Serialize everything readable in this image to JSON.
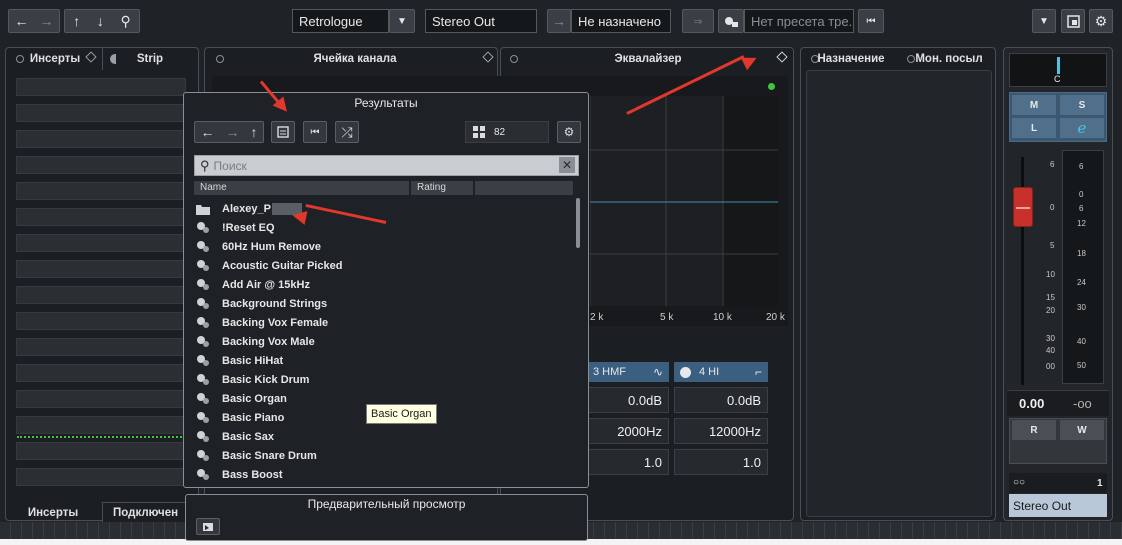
{
  "toolbar": {
    "nav_back_icon": "←",
    "nav_forward_icon": "→",
    "nav_up_icon": "↑",
    "nav_down_icon": "↓",
    "search_icon": "⚲",
    "plugin_name": "Retrologue",
    "output_name": "Stereo Out",
    "assign_arrow_icon": "→",
    "assign_status": "Не назначено",
    "preset_placeholder": "Нет пресета тре.",
    "skip_back_icon": "⏮",
    "dropdown_icon": "▼"
  },
  "tabs": {
    "inserts": "Инсерты",
    "strip": "Strip",
    "channel_cell": "Ячейка канала",
    "equalizer": "Эквалайзер",
    "routing": "Назначение",
    "mon_sends": "Мон. посыл"
  },
  "bottom_tabs": {
    "inserts": "Инсерты",
    "connections": "Подключен"
  },
  "eq": {
    "freq_labels": [
      "2 k",
      "5 k",
      "10 k",
      "20 k"
    ],
    "bands": [
      {
        "name": "3 HMF",
        "gain": "0.0dB",
        "freq": "2000Hz",
        "q": "1.0"
      },
      {
        "name": "4 HI",
        "gain": "0.0dB",
        "freq": "12000Hz",
        "q": "1.0"
      }
    ]
  },
  "results_dialog": {
    "title": "Результаты",
    "count": "82",
    "search_placeholder": "Поиск",
    "columns": [
      "Name",
      "Rating"
    ],
    "folder": "Alexey_P",
    "presets": [
      "!Reset EQ",
      "60Hz Hum Remove",
      "Acoustic Guitar Picked",
      "Add Air @ 15kHz",
      "Background Strings",
      "Backing Vox Female",
      "Backing Vox Male",
      "Basic HiHat",
      "Basic Kick Drum",
      "Basic Organ",
      "Basic Piano",
      "Basic Sax",
      "Basic Snare Drum",
      "Bass Boost"
    ],
    "tooltip": "Basic Organ"
  },
  "preview_dialog": {
    "title": "Предварительный просмотр"
  },
  "mixer": {
    "pan_label": "C",
    "btn_m": "M",
    "btn_s": "S",
    "btn_l": "L",
    "btn_e": "e",
    "fader_scale": [
      "6",
      "0",
      "5",
      "10",
      "15",
      "20",
      "30",
      "40",
      "00"
    ],
    "meter_scale": [
      "6",
      "0",
      "6",
      "12",
      "18",
      "24",
      "30",
      "40",
      "50"
    ],
    "volume": "0.00",
    "peak": "-oo",
    "btn_r": "R",
    "btn_w": "W",
    "channel_number": "1",
    "channel_name": "Stereo Out"
  },
  "colors": {
    "accent_blue": "#4ec3e8",
    "fader_red": "#c8302c",
    "annotation_red": "#e0382c"
  }
}
